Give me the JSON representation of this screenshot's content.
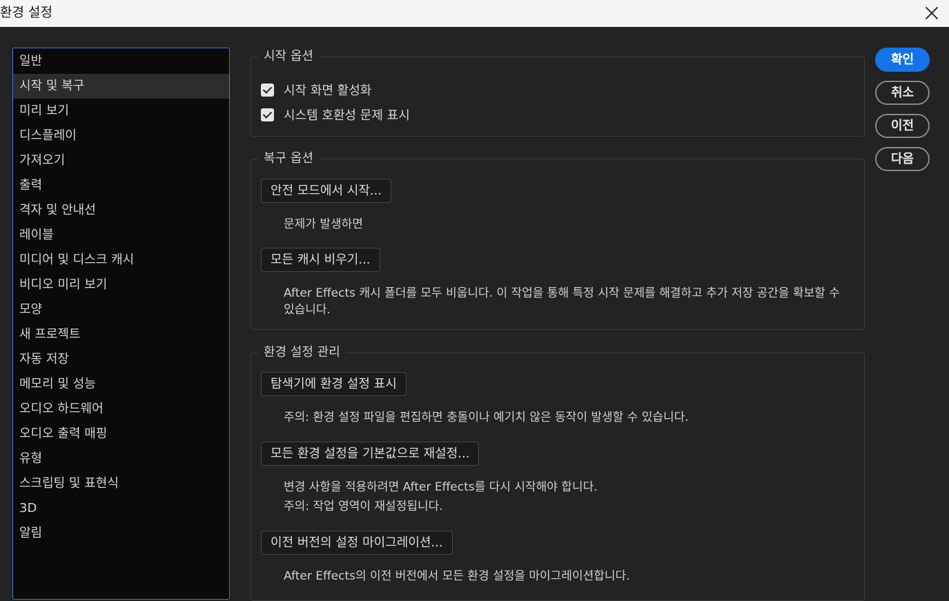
{
  "window": {
    "title": "환경 설정"
  },
  "sidebar": {
    "items": [
      "일반",
      "시작 및 복구",
      "미리 보기",
      "디스플레이",
      "가져오기",
      "출력",
      "격자 및 안내선",
      "레이블",
      "미디어 및 디스크 캐시",
      "비디오 미리 보기",
      "모양",
      "새 프로젝트",
      "자동 저장",
      "메모리 및 성능",
      "오디오 하드웨어",
      "오디오 출력 매핑",
      "유형",
      "스크립팅 및 표현식",
      "3D",
      "알림"
    ],
    "active": "시작 및 복구"
  },
  "startup": {
    "legend": "시작 옵션",
    "opt1": "시작 화면 활성화",
    "opt2": "시스템 호환성 문제 표시"
  },
  "recovery": {
    "legend": "복구 옵션",
    "safe_btn": "안전 모드에서 시작...",
    "safe_desc": "문제가 발생하면",
    "cache_btn": "모든 캐시 비우기...",
    "cache_desc": "After Effects 캐시 폴더를 모두 비웁니다. 이 작업을 통해 특정 시작 문제를 해결하고 추가 저장 공간을 확보할 수 있습니다."
  },
  "prefs": {
    "legend": "환경 설정 관리",
    "show_btn": "탐색기에 환경 설정 표시",
    "show_desc": "주의: 환경 설정 파일을 편집하면 충돌이나 예기치 않은 동작이 발생할 수 있습니다.",
    "reset_btn": "모든 환경 설정을 기본값으로 재설정...",
    "reset_desc1": "변경 사항을 적용하려면 After Effects를 다시 시작해야 합니다.",
    "reset_desc2": "주의: 작업 영역이 재설정됩니다.",
    "migrate_btn": "이전 버전의 설정 마이그레이션...",
    "migrate_desc": "After Effects의 이전 버전에서 모든 환경 설정을 마이그레이션합니다."
  },
  "actions": {
    "ok": "확인",
    "cancel": "취소",
    "prev": "이전",
    "next": "다음"
  }
}
